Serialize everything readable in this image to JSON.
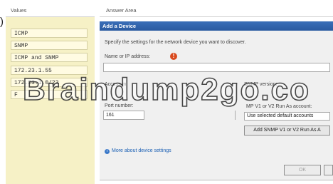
{
  "question_marker": ")",
  "values_pane": {
    "header": "Values",
    "items": [
      "ICMP",
      "SNMP",
      "ICMP and SNMP",
      "172.23.1.55",
      "172.23.1.0/23",
      "F"
    ]
  },
  "answer_area": {
    "header": "Answer Area",
    "dialog": {
      "title": "Add a Device",
      "instructions": "Specify the settings for the network device you want to discover.",
      "name_label": "Name or IP address:",
      "name_value": "",
      "access_mode_label": "Access m",
      "snmp_version_label": "SNMP version:",
      "port_label": "Port number:",
      "port_value": "161",
      "run_as_label": "MP V1 or V2 Run As account:",
      "run_as_value": "Use selected default accounts",
      "add_run_as_button": "Add SNMP V1 or V2 Run As A",
      "more_settings_link": "More about device settings",
      "ok_button": "OK"
    }
  },
  "watermark": "Braindump2go.co"
}
